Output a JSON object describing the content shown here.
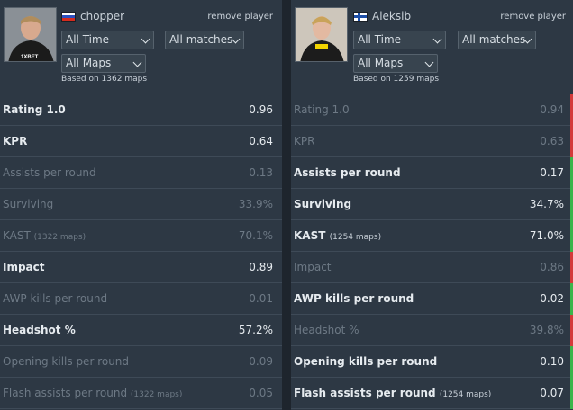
{
  "players": [
    {
      "name": "chopper",
      "remove_label": "remove player",
      "time_filter": "All Time",
      "match_filter": "All matches",
      "map_filter": "All Maps",
      "based_on": "Based on 1362 maps",
      "flag": "russia-flag",
      "stats": [
        {
          "label": "Rating 1.0",
          "sub": "",
          "value": "0.96",
          "state": "best"
        },
        {
          "label": "KPR",
          "sub": "",
          "value": "0.64",
          "state": "best"
        },
        {
          "label": "Assists per round",
          "sub": "",
          "value": "0.13",
          "state": "worse"
        },
        {
          "label": "Surviving",
          "sub": "",
          "value": "33.9%",
          "state": "worse"
        },
        {
          "label": "KAST",
          "sub": "(1322 maps)",
          "value": "70.1%",
          "state": "worse"
        },
        {
          "label": "Impact",
          "sub": "",
          "value": "0.89",
          "state": "best"
        },
        {
          "label": "AWP kills per round",
          "sub": "",
          "value": "0.01",
          "state": "worse"
        },
        {
          "label": "Headshot %",
          "sub": "",
          "value": "57.2%",
          "state": "best"
        },
        {
          "label": "Opening kills per round",
          "sub": "",
          "value": "0.09",
          "state": "worse"
        },
        {
          "label": "Flash assists per round",
          "sub": "(1322 maps)",
          "value": "0.05",
          "state": "worse"
        }
      ]
    },
    {
      "name": "Aleksib",
      "remove_label": "remove player",
      "time_filter": "All Time",
      "match_filter": "All matches",
      "map_filter": "All Maps",
      "based_on": "Based on 1259 maps",
      "flag": "finland-flag",
      "stats": [
        {
          "label": "Rating 1.0",
          "sub": "",
          "value": "0.94",
          "state": "worse",
          "bar": "bad"
        },
        {
          "label": "KPR",
          "sub": "",
          "value": "0.63",
          "state": "worse",
          "bar": "bad"
        },
        {
          "label": "Assists per round",
          "sub": "",
          "value": "0.17",
          "state": "best",
          "bar": "good"
        },
        {
          "label": "Surviving",
          "sub": "",
          "value": "34.7%",
          "state": "best",
          "bar": "good"
        },
        {
          "label": "KAST",
          "sub": "(1254 maps)",
          "value": "71.0%",
          "state": "best",
          "bar": "good"
        },
        {
          "label": "Impact",
          "sub": "",
          "value": "0.86",
          "state": "worse",
          "bar": "bad"
        },
        {
          "label": "AWP kills per round",
          "sub": "",
          "value": "0.02",
          "state": "best",
          "bar": "good"
        },
        {
          "label": "Headshot %",
          "sub": "",
          "value": "39.8%",
          "state": "worse",
          "bar": "bad"
        },
        {
          "label": "Opening kills per round",
          "sub": "",
          "value": "0.10",
          "state": "best",
          "bar": "good"
        },
        {
          "label": "Flash assists per round",
          "sub": "(1254 maps)",
          "value": "0.07",
          "state": "best",
          "bar": "good"
        }
      ]
    }
  ],
  "colors": {
    "panel": "#2d3844",
    "better_bar": "#3ab54a",
    "worse_bar": "#d43a3a",
    "dim_text": "#6d7985",
    "bright_text": "#e6ebef"
  }
}
